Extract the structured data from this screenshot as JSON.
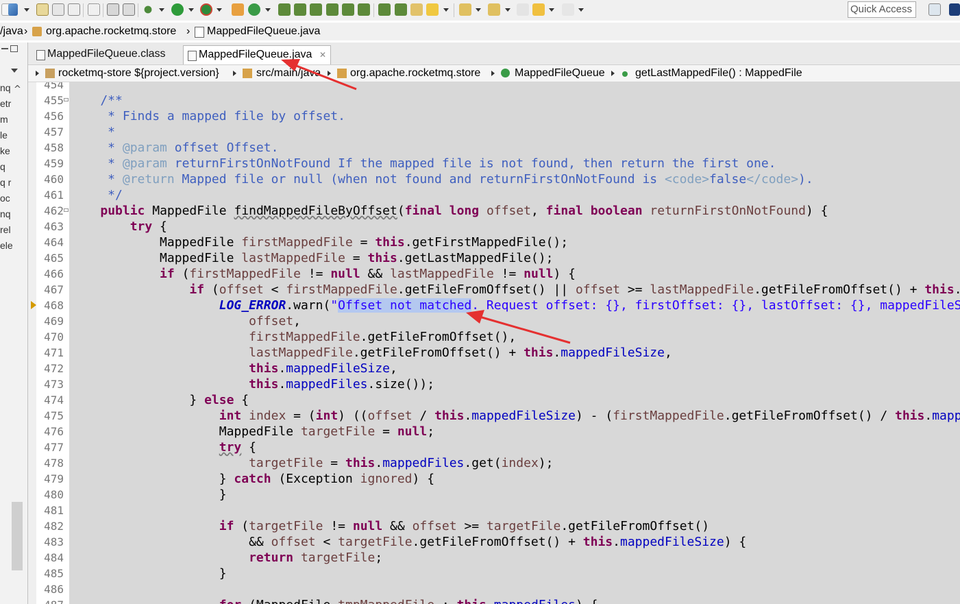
{
  "toolbar": {
    "quick_access": "Quick Access"
  },
  "breadcrumb_top": {
    "folder": "/java",
    "package": "org.apache.rocketmq.store",
    "file": "MappedFileQueue.java"
  },
  "left_panel": {
    "fragments": [
      "nq",
      "etr",
      "m",
      "le",
      "ke",
      "q",
      "q r",
      "oc",
      "nq",
      "rel",
      "ele"
    ]
  },
  "tabs": [
    {
      "label": "MappedFileQueue.class",
      "active": false
    },
    {
      "label": "MappedFileQueue.java",
      "active": true
    }
  ],
  "breadcrumb_editor": {
    "project": "rocketmq-store ${project.version}",
    "source": "src/main/java",
    "package": "org.apache.rocketmq.store",
    "class": "MappedFileQueue",
    "method": "getLastMappedFile() : MappedFile"
  },
  "code": {
    "lines": [
      {
        "n": "454",
        "text": ""
      },
      {
        "n": "455",
        "text": "    /**"
      },
      {
        "n": "456",
        "text": "     * Finds a mapped file by offset."
      },
      {
        "n": "457",
        "text": "     *"
      },
      {
        "n": "458",
        "text": "     * @param offset Offset."
      },
      {
        "n": "459",
        "text": "     * @param returnFirstOnNotFound If the mapped file is not found, then return the first one."
      },
      {
        "n": "460",
        "text": "     * @return Mapped file or null (when not found and returnFirstOnNotFound is <code>false</code>)."
      },
      {
        "n": "461",
        "text": "     */"
      },
      {
        "n": "462",
        "text": "    public MappedFile findMappedFileByOffset(final long offset, final boolean returnFirstOnNotFound) {"
      },
      {
        "n": "463",
        "text": "        try {"
      },
      {
        "n": "464",
        "text": "            MappedFile firstMappedFile = this.getFirstMappedFile();"
      },
      {
        "n": "465",
        "text": "            MappedFile lastMappedFile = this.getLastMappedFile();"
      },
      {
        "n": "466",
        "text": "            if (firstMappedFile != null && lastMappedFile != null) {"
      },
      {
        "n": "467",
        "text": "                if (offset < firstMappedFile.getFileFromOffset() || offset >= lastMappedFile.getFileFromOffset() + this.mappedFileSize) {"
      },
      {
        "n": "468",
        "text": "                    LOG_ERROR.warn(\"Offset not matched. Request offset: {}, firstOffset: {}, lastOffset: {}, mappedFileSize: {}, mappedFiles count: {}\","
      },
      {
        "n": "469",
        "text": "                        offset,"
      },
      {
        "n": "470",
        "text": "                        firstMappedFile.getFileFromOffset(),"
      },
      {
        "n": "471",
        "text": "                        lastMappedFile.getFileFromOffset() + this.mappedFileSize,"
      },
      {
        "n": "472",
        "text": "                        this.mappedFileSize,"
      },
      {
        "n": "473",
        "text": "                        this.mappedFiles.size());"
      },
      {
        "n": "474",
        "text": "                } else {"
      },
      {
        "n": "475",
        "text": "                    int index = (int) ((offset / this.mappedFileSize) - (firstMappedFile.getFileFromOffset() / this.mappedFileSize));"
      },
      {
        "n": "476",
        "text": "                    MappedFile targetFile = null;"
      },
      {
        "n": "477",
        "text": "                    try {"
      },
      {
        "n": "478",
        "text": "                        targetFile = this.mappedFiles.get(index);"
      },
      {
        "n": "479",
        "text": "                    } catch (Exception ignored) {"
      },
      {
        "n": "480",
        "text": "                    }"
      },
      {
        "n": "481",
        "text": ""
      },
      {
        "n": "482",
        "text": "                    if (targetFile != null && offset >= targetFile.getFileFromOffset()"
      },
      {
        "n": "483",
        "text": "                        && offset < targetFile.getFileFromOffset() + this.mappedFileSize) {"
      },
      {
        "n": "484",
        "text": "                        return targetFile;"
      },
      {
        "n": "485",
        "text": "                    }"
      },
      {
        "n": "486",
        "text": ""
      },
      {
        "n": "487",
        "text": "                    for (MappedFile tmpMappedFile : this.mappedFiles) {"
      }
    ]
  },
  "annotations": {
    "arrow_color": "#e53030"
  }
}
